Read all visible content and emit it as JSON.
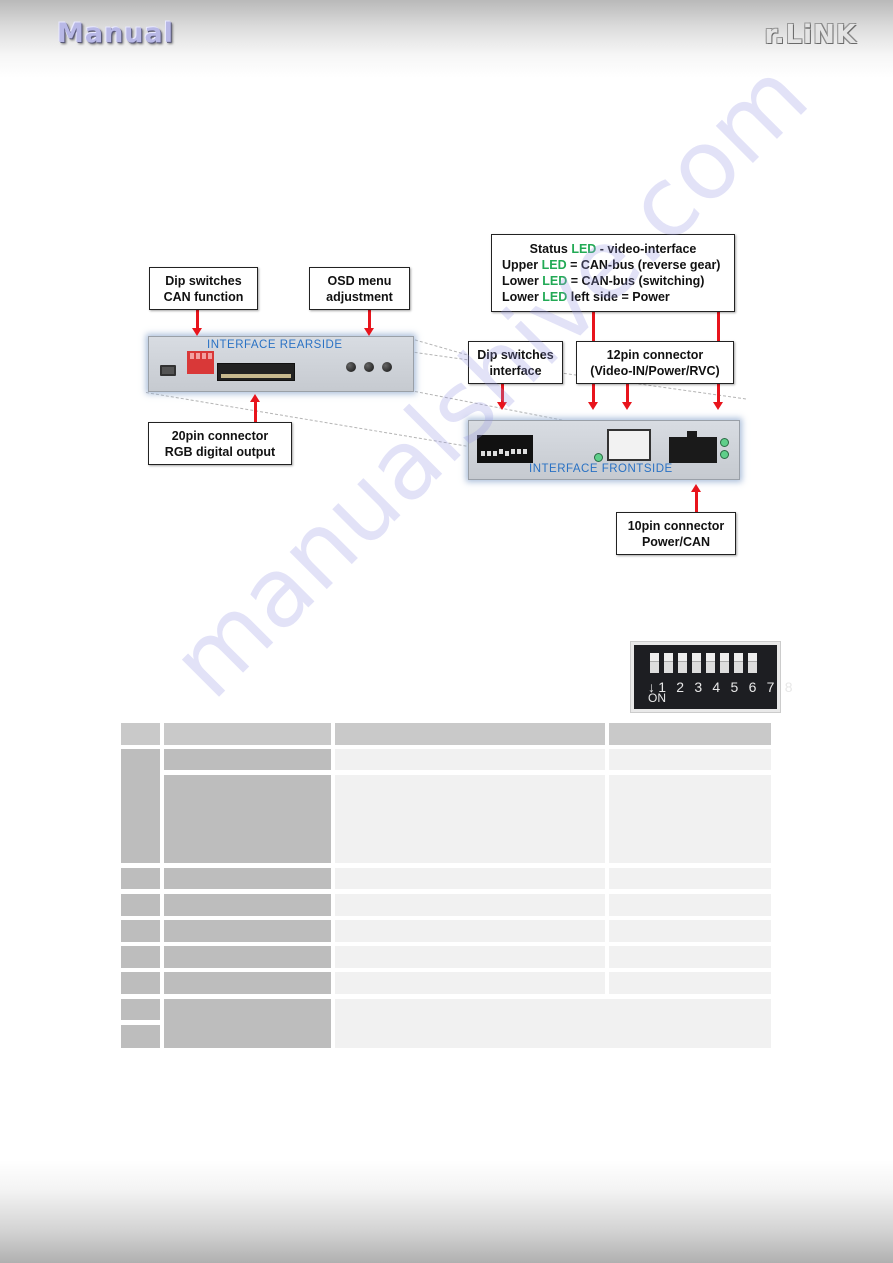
{
  "header": {
    "left_brand": "Manual",
    "right_brand": "r.LiNK"
  },
  "watermark": "manualshive.com",
  "diagram": {
    "callouts": {
      "dip_can": [
        "Dip switches",
        "CAN function"
      ],
      "osd": [
        "OSD menu",
        "adjustment"
      ],
      "status_led": {
        "line1_pre": "Status ",
        "line1_led": "LED",
        "line1_post": " - video-interface",
        "line2_pre": "Upper ",
        "line2_led": "LED",
        "line2_post": " = CAN-bus (reverse gear)",
        "line3_pre": "Lower ",
        "line3_led": "LED",
        "line3_post": " = CAN-bus (switching)",
        "line4_pre": "Lower ",
        "line4_led": "LED",
        "line4_post": " left side = Power"
      },
      "dip_interface": [
        "Dip switches",
        "interface"
      ],
      "pin12": [
        "12pin connector",
        "(Video-IN/Power/RVC)"
      ],
      "pin20": [
        "20pin connector",
        "RGB digital output"
      ],
      "pin10": [
        "10pin connector",
        "Power/CAN"
      ]
    },
    "rear_label": "INTERFACE   REARSIDE",
    "front_label": "INTERFACE   FRONTSIDE",
    "front_dip_numbers": "1 2 3 4 5 6 7 8",
    "front_dip_on": "ON"
  },
  "dip_photo": {
    "numbers": "↓1 2 3 4 5 6 7 8",
    "on_label": "ON"
  },
  "colors": {
    "arrow": "#e8141c",
    "led_text": "#22aa55",
    "device_label": "#2a72c4",
    "table_header": "#c9c9c9",
    "table_dark": "#bdbdbd",
    "table_light": "#f1f1f1"
  },
  "table": {
    "header": [
      "",
      "",
      "",
      ""
    ],
    "rows": [
      [
        "",
        "",
        "",
        ""
      ],
      [
        "",
        "",
        "",
        ""
      ],
      [
        "",
        "",
        "",
        ""
      ],
      [
        "",
        "",
        "",
        ""
      ],
      [
        "",
        "",
        "",
        ""
      ],
      [
        "",
        "",
        "",
        ""
      ],
      [
        "",
        "",
        "",
        ""
      ],
      [
        "",
        "",
        ""
      ]
    ]
  }
}
